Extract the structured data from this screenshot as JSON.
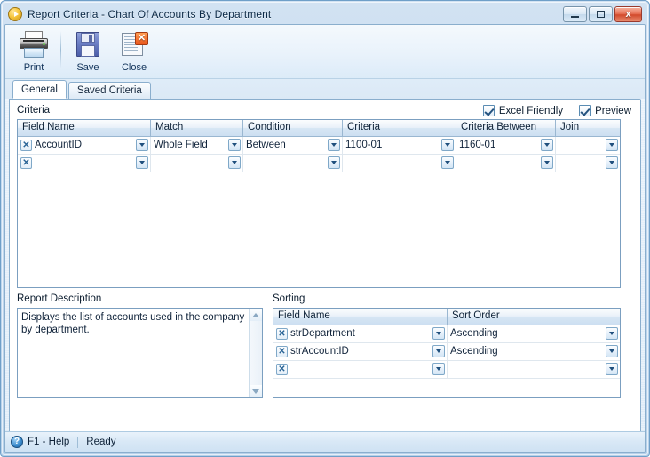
{
  "window": {
    "title": "Report Criteria - Chart Of Accounts By Department",
    "app_icon": "play-circle-icon",
    "buttons": {
      "minimize": "minimize-icon",
      "maximize": "maximize-icon",
      "close": "x"
    }
  },
  "toolbar": {
    "items": [
      {
        "label": "Print",
        "icon": "printer-icon"
      },
      {
        "label": "Save",
        "icon": "floppy-disk-icon"
      },
      {
        "label": "Close",
        "icon": "document-close-icon"
      }
    ]
  },
  "tabs": [
    {
      "label": "General",
      "active": true
    },
    {
      "label": "Saved Criteria",
      "active": false
    }
  ],
  "options": [
    {
      "label": "Excel Friendly",
      "checked": true
    },
    {
      "label": "Preview",
      "checked": true
    }
  ],
  "criteria": {
    "group_label": "Criteria",
    "columns": [
      "Field Name",
      "Match",
      "Condition",
      "Criteria",
      "Criteria Between",
      "Join"
    ],
    "rows": [
      {
        "field_name": "AccountID",
        "match": "Whole Field",
        "condition": "Between",
        "criteria": "1100-01",
        "criteria_between": "1160-01",
        "join": ""
      },
      {
        "field_name": "",
        "match": "",
        "condition": "",
        "criteria": "",
        "criteria_between": "",
        "join": ""
      }
    ]
  },
  "report_description": {
    "group_label": "Report Description",
    "text": "Displays the list of accounts used in the company by department."
  },
  "sorting": {
    "group_label": "Sorting",
    "columns": [
      "Field Name",
      "Sort Order"
    ],
    "rows": [
      {
        "field_name": "strDepartment",
        "sort_order": "Ascending"
      },
      {
        "field_name": "strAccountID",
        "sort_order": "Ascending"
      },
      {
        "field_name": "",
        "sort_order": ""
      }
    ]
  },
  "statusbar": {
    "help_icon": "question-circle-icon",
    "help_label": "F1 - Help",
    "status": "Ready"
  },
  "colors": {
    "window_frame": "#b7d1ea",
    "accent_blue": "#25537f",
    "close_red": "#d24a2c",
    "grid_border": "#7b9fc0"
  }
}
